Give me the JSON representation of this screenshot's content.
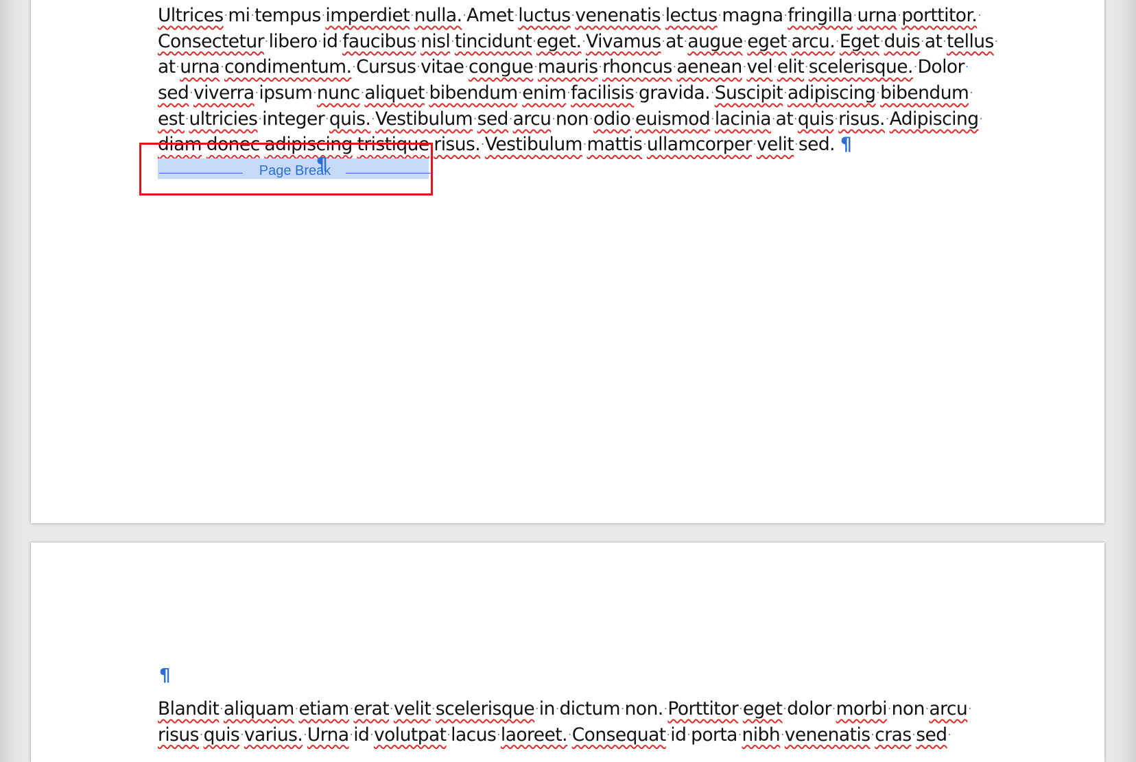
{
  "document": {
    "page1": {
      "paragraph_lines": [
        [
          {
            "t": "Ultrices",
            "s": true
          },
          {
            "t": " mi"
          },
          {
            "t": " tempus"
          },
          {
            "t": " "
          },
          {
            "t": "imperdiet",
            "s": true
          },
          {
            "t": " "
          },
          {
            "t": "nulla.",
            "s": true
          },
          {
            "t": " Amet"
          },
          {
            "t": " "
          },
          {
            "t": "luctus",
            "s": true
          },
          {
            "t": " "
          },
          {
            "t": "venenatis",
            "s": true
          },
          {
            "t": " "
          },
          {
            "t": "lectus",
            "s": true
          },
          {
            "t": " magna"
          },
          {
            "t": " "
          },
          {
            "t": "fringilla",
            "s": true
          },
          {
            "t": " "
          },
          {
            "t": "urna",
            "s": true
          },
          {
            "t": " "
          },
          {
            "t": "porttitor.",
            "s": true
          },
          {
            "t": " "
          }
        ],
        [
          {
            "t": "Consectetur",
            "s": true
          },
          {
            "t": " libero"
          },
          {
            "t": " id"
          },
          {
            "t": " "
          },
          {
            "t": "faucibus",
            "s": true
          },
          {
            "t": " "
          },
          {
            "t": "nisl",
            "s": true
          },
          {
            "t": " "
          },
          {
            "t": "tincidunt",
            "s": true
          },
          {
            "t": " "
          },
          {
            "t": "eget.",
            "s": true
          },
          {
            "t": " "
          },
          {
            "t": "Vivamus",
            "s": true
          },
          {
            "t": " at"
          },
          {
            "t": " "
          },
          {
            "t": "augue",
            "s": true
          },
          {
            "t": " "
          },
          {
            "t": "eget",
            "s": true
          },
          {
            "t": " "
          },
          {
            "t": "arcu.",
            "s": true
          },
          {
            "t": " "
          },
          {
            "t": "Eget",
            "s": true
          },
          {
            "t": " "
          },
          {
            "t": "duis",
            "s": true
          },
          {
            "t": " at"
          },
          {
            "t": " "
          },
          {
            "t": "tellus",
            "s": true
          },
          {
            "t": " "
          }
        ],
        [
          {
            "t": "at"
          },
          {
            "t": " "
          },
          {
            "t": "urna",
            "s": true
          },
          {
            "t": " "
          },
          {
            "t": "condimentum.",
            "s": true
          },
          {
            "t": " Cursus"
          },
          {
            "t": " vitae"
          },
          {
            "t": " "
          },
          {
            "t": "congue",
            "s": true
          },
          {
            "t": " "
          },
          {
            "t": "mauris",
            "s": true
          },
          {
            "t": " "
          },
          {
            "t": "rhoncus",
            "s": true
          },
          {
            "t": " "
          },
          {
            "t": "aenean",
            "s": true
          },
          {
            "t": " "
          },
          {
            "t": "vel",
            "s": true
          },
          {
            "t": " "
          },
          {
            "t": "elit",
            "s": true
          },
          {
            "t": " "
          },
          {
            "t": "scelerisque.",
            "s": true
          },
          {
            "t": " Dolor"
          },
          {
            "t": " "
          }
        ],
        [
          {
            "t": "sed",
            "s": true
          },
          {
            "t": " "
          },
          {
            "t": "viverra",
            "s": true
          },
          {
            "t": " ipsum"
          },
          {
            "t": " "
          },
          {
            "t": "nunc",
            "s": true
          },
          {
            "t": " "
          },
          {
            "t": "aliquet",
            "s": true
          },
          {
            "t": " "
          },
          {
            "t": "bibendum",
            "s": true
          },
          {
            "t": " "
          },
          {
            "t": "enim",
            "s": true
          },
          {
            "t": " "
          },
          {
            "t": "facilisis",
            "s": true
          },
          {
            "t": " gravida."
          },
          {
            "t": " "
          },
          {
            "t": "Suscipit",
            "s": true
          },
          {
            "t": " "
          },
          {
            "t": "adipiscing",
            "s": true
          },
          {
            "t": " "
          },
          {
            "t": "bibendum",
            "s": true
          },
          {
            "t": " "
          }
        ],
        [
          {
            "t": "est",
            "s": true
          },
          {
            "t": " "
          },
          {
            "t": "ultricies",
            "s": true
          },
          {
            "t": " integer"
          },
          {
            "t": " "
          },
          {
            "t": "quis.",
            "s": true
          },
          {
            "t": " "
          },
          {
            "t": "Vestibulum",
            "s": true
          },
          {
            "t": " "
          },
          {
            "t": "sed",
            "s": true
          },
          {
            "t": " "
          },
          {
            "t": "arcu",
            "s": true
          },
          {
            "t": " non"
          },
          {
            "t": " "
          },
          {
            "t": "odio",
            "s": true
          },
          {
            "t": " "
          },
          {
            "t": "euismod",
            "s": true
          },
          {
            "t": " "
          },
          {
            "t": "lacinia",
            "s": true
          },
          {
            "t": " at"
          },
          {
            "t": " "
          },
          {
            "t": "quis",
            "s": true
          },
          {
            "t": " "
          },
          {
            "t": "risus.",
            "s": true
          },
          {
            "t": " "
          },
          {
            "t": "Adipiscing",
            "s": true
          },
          {
            "t": " "
          }
        ],
        [
          {
            "t": "diam",
            "s": true
          },
          {
            "t": " "
          },
          {
            "t": "donec",
            "s": true
          },
          {
            "t": " "
          },
          {
            "t": "adipiscing",
            "s": true
          },
          {
            "t": " "
          },
          {
            "t": "tristique",
            "s": true
          },
          {
            "t": " "
          },
          {
            "t": "risus.",
            "s": true
          },
          {
            "t": " "
          },
          {
            "t": "Vestibulum",
            "s": true
          },
          {
            "t": " "
          },
          {
            "t": "mattis",
            "s": true
          },
          {
            "t": " "
          },
          {
            "t": "ullamcorper",
            "s": true
          },
          {
            "t": " "
          },
          {
            "t": "velit",
            "s": true
          },
          {
            "t": " sed."
          }
        ]
      ],
      "paragraph_end_mark": "¶",
      "page_break_label": "Page Break",
      "page_break_end_mark": "¶"
    },
    "page2": {
      "empty_paragraph_mark": "¶",
      "paragraph_lines": [
        [
          {
            "t": "Blandit",
            "s": true
          },
          {
            "t": " "
          },
          {
            "t": "aliquam",
            "s": true
          },
          {
            "t": " "
          },
          {
            "t": "etiam",
            "s": true
          },
          {
            "t": " "
          },
          {
            "t": "erat",
            "s": true
          },
          {
            "t": " "
          },
          {
            "t": "velit",
            "s": true
          },
          {
            "t": " "
          },
          {
            "t": "scelerisque",
            "s": true
          },
          {
            "t": " in"
          },
          {
            "t": " dictum"
          },
          {
            "t": " non."
          },
          {
            "t": " "
          },
          {
            "t": "Porttitor",
            "s": true
          },
          {
            "t": " "
          },
          {
            "t": "eget",
            "s": true
          },
          {
            "t": " dolor"
          },
          {
            "t": " "
          },
          {
            "t": "morbi",
            "s": true
          },
          {
            "t": " non"
          },
          {
            "t": " "
          },
          {
            "t": "arcu",
            "s": true
          },
          {
            "t": " "
          }
        ],
        [
          {
            "t": "risus",
            "s": true
          },
          {
            "t": " "
          },
          {
            "t": "quis",
            "s": true
          },
          {
            "t": " "
          },
          {
            "t": "varius.",
            "s": true
          },
          {
            "t": " "
          },
          {
            "t": "Urna",
            "s": true
          },
          {
            "t": " id"
          },
          {
            "t": " "
          },
          {
            "t": "volutpat",
            "s": true
          },
          {
            "t": " lacus"
          },
          {
            "t": " "
          },
          {
            "t": "laoreet.",
            "s": true
          },
          {
            "t": " "
          },
          {
            "t": "Consequat",
            "s": true
          },
          {
            "t": " id"
          },
          {
            "t": " porta"
          },
          {
            "t": " "
          },
          {
            "t": "nibh",
            "s": true
          },
          {
            "t": " "
          },
          {
            "t": "venenatis",
            "s": true
          },
          {
            "t": " "
          },
          {
            "t": "cras",
            "s": true
          },
          {
            "t": " "
          },
          {
            "t": "sed",
            "s": true
          },
          {
            "t": " "
          }
        ]
      ]
    }
  },
  "colors": {
    "formatting_marks": "#2e6fd6",
    "spelling_underline": "#e32b2b",
    "page_break_highlight": "#c6daf7",
    "annotation_box": "#e3141a"
  }
}
